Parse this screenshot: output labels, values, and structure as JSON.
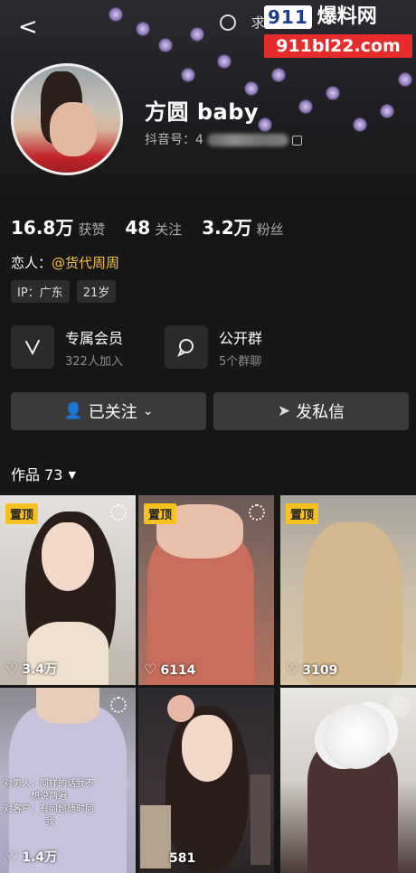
{
  "header": {
    "back_glyph": "<",
    "top_text": "求更新",
    "watermark": {
      "badge": "911",
      "brand": "爆料网",
      "url": "911bl22.com"
    }
  },
  "profile": {
    "name": "方圆 baby",
    "douyin_id_label": "抖音号：4"
  },
  "stats": [
    {
      "number": "16.8万",
      "label": "获赞"
    },
    {
      "number": "48",
      "label": "关注"
    },
    {
      "number": "3.2万",
      "label": "粉丝"
    }
  ],
  "lover": {
    "label": "恋人：",
    "value": "@货代周周"
  },
  "tags": [
    "IP：广东",
    "21岁"
  ],
  "features": [
    {
      "title": "专属会员",
      "subtitle": "322人加入",
      "icon": "v-icon"
    },
    {
      "title": "公开群",
      "subtitle": "5个群聊",
      "icon": "chat-icon"
    }
  ],
  "buttons": {
    "followed": "已关注",
    "message": "发私信"
  },
  "works": {
    "label": "作品 73"
  },
  "grid": [
    {
      "pinned": "置顶",
      "likes": "3.4万"
    },
    {
      "pinned": "置顶",
      "likes": "6114"
    },
    {
      "pinned": "置顶",
      "likes": "3109"
    },
    {
      "likes": "1.4万",
      "caption_lines": [
        "对男人：同样的话我不",
        "想说两遍",
        "对客户：有问题随时问",
        "我"
      ]
    },
    {
      "likes": "581"
    },
    {
      "likes": ""
    }
  ],
  "colors": {
    "background": "#161616",
    "accent_yellow": "#f5c244",
    "pin_yellow": "#f7c21f",
    "watermark_red": "#e52b2b"
  }
}
